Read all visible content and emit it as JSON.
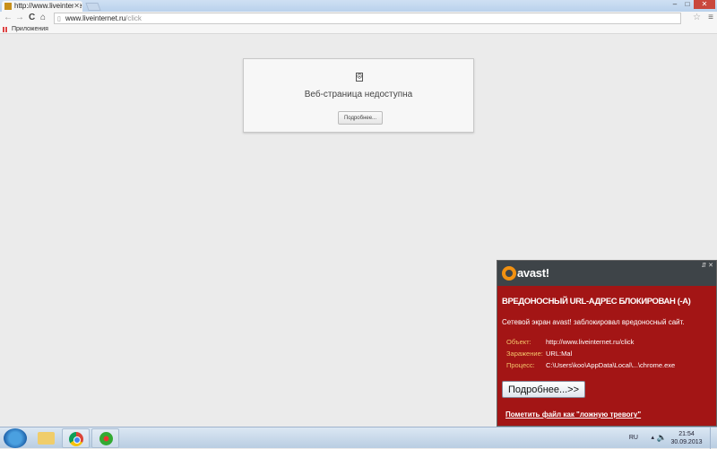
{
  "browser": {
    "tab_title": "http://www.liveinternet.ru/click",
    "url_host": "www.liveinternet.ru",
    "url_path": "/click",
    "bookmarks_apps": "Приложения"
  },
  "error_page": {
    "message": "Веб-страница недоступна",
    "details_button": "Подробнее..."
  },
  "avast": {
    "brand": "avast!",
    "title": "ВРЕДОНОСНЫЙ URL-АДРЕС БЛОКИРОВАН (-А)",
    "description": "Сетевой экран avast! заблокировал вредоносный сайт.",
    "rows": [
      {
        "label": "Объект:",
        "value": "http://www.liveinternet.ru/click"
      },
      {
        "label": "Заражение:",
        "value": "URL:Mal"
      },
      {
        "label": "Процесс:",
        "value": "C:\\Users\\koo\\AppData\\Local\\...\\chrome.exe"
      }
    ],
    "more_button": "Подробнее...>>",
    "false_positive_link": "Пометить файл как \"ложную тревогу\""
  },
  "taskbar": {
    "language": "RU",
    "time": "21:54",
    "date": "30.09.2013"
  }
}
